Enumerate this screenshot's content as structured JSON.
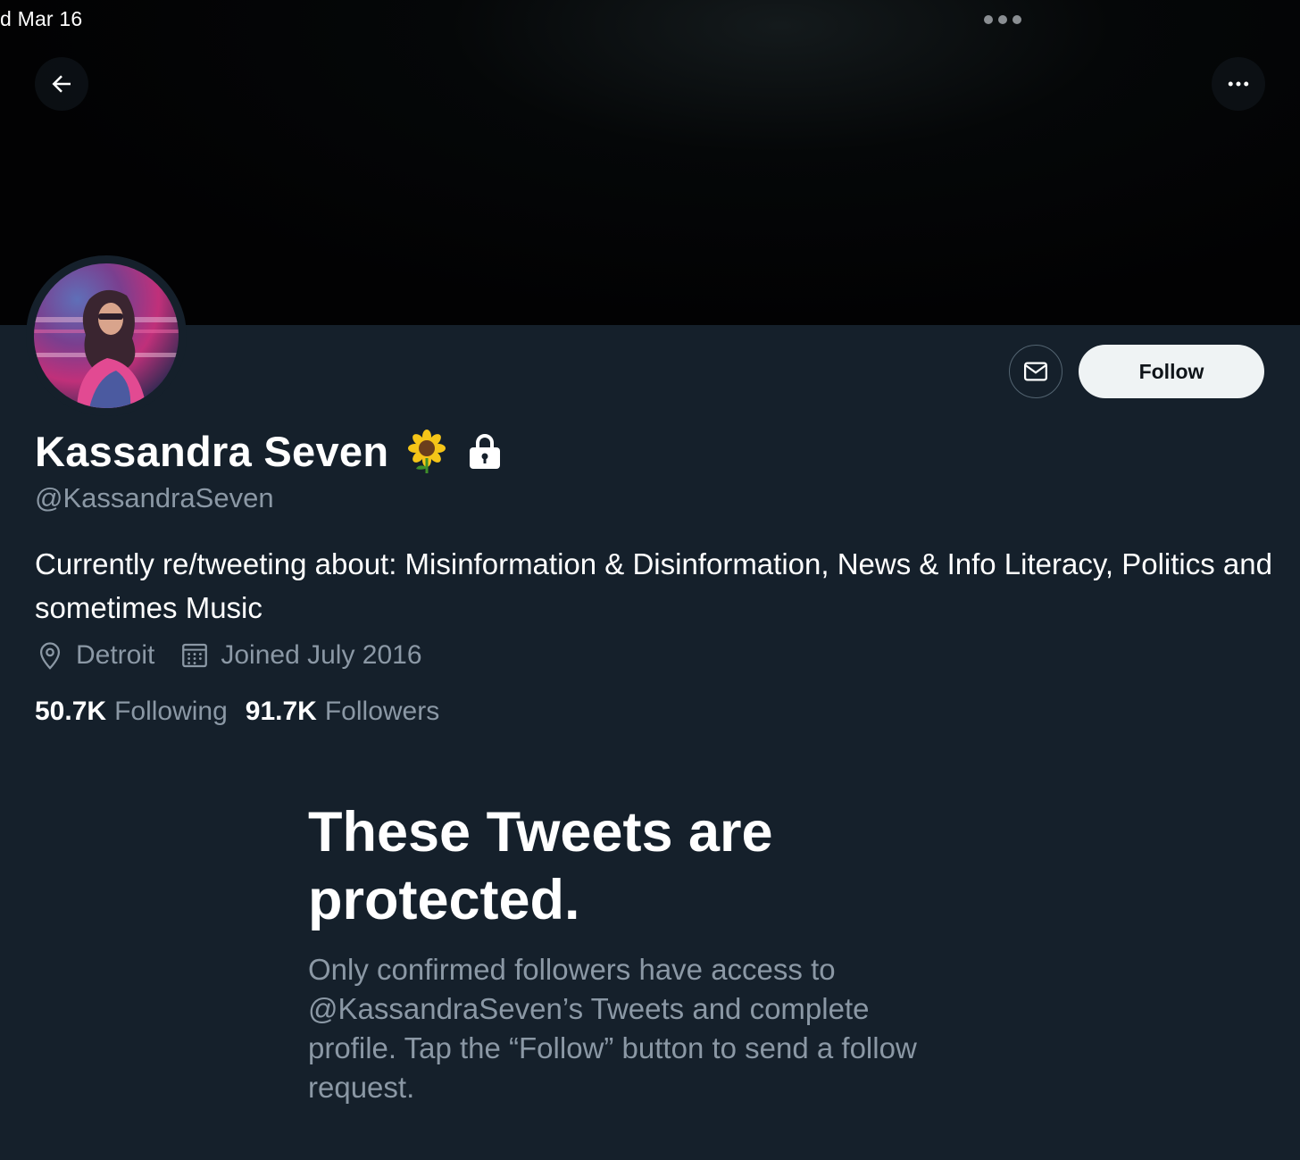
{
  "status_bar": {
    "time": "d Mar 16"
  },
  "header": {
    "back_icon": "arrow-left-icon",
    "more_icon": "more-horizontal-icon"
  },
  "profile": {
    "avatar_icon": "profile-avatar",
    "display_name": "Kassandra Seven",
    "emoji": "sunflower",
    "protected_icon": "lock-icon",
    "handle": "@KassandraSeven",
    "bio": "Currently re/tweeting about: Misinformation & Disinformation, News & Info Literacy, Politics and sometimes Music",
    "location": "Detroit",
    "joined": "Joined July 2016",
    "following_count": "50.7K",
    "following_label": "Following",
    "followers_count": "91.7K",
    "followers_label": "Followers"
  },
  "actions": {
    "message_icon": "mail-icon",
    "follow_label": "Follow"
  },
  "protected_notice": {
    "title": "These Tweets are protected.",
    "body": "Only confirmed followers have access to @KassandraSeven’s Tweets and complete profile. Tap the “Follow” button to send a follow request."
  },
  "colors": {
    "background": "#15202b",
    "secondary_text": "#8b98a5",
    "follow_button_bg": "#eff3f4"
  }
}
